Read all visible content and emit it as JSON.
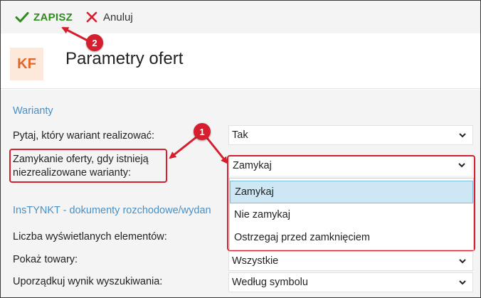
{
  "toolbar": {
    "save_label": "ZAPISZ",
    "cancel_label": "Anuluj"
  },
  "header": {
    "logo_text": "KF",
    "title": "Parametry ofert"
  },
  "sections": {
    "warianty": {
      "title": "Warianty",
      "rows": [
        {
          "label": "Pytaj, który wariant realizować:",
          "value": "Tak"
        },
        {
          "label_line1": "Zamykanie oferty, gdy istnieją",
          "label_line2": "niezrealizowane warianty:",
          "value": "Zamykaj"
        }
      ]
    },
    "instynkt": {
      "title": "InsTYNKT - dokumenty rozchodowe/wydan",
      "rows": [
        {
          "label": "Liczba wyświetlanych elementów:"
        },
        {
          "label": "Pokaż towary:",
          "value": "Wszystkie"
        },
        {
          "label": "Uporządkuj wynik wyszukiwania:",
          "value": "Według symbolu"
        }
      ]
    }
  },
  "dropdown": {
    "options": [
      "Zamykaj",
      "Nie zamykaj",
      "Ostrzegaj przed zamknięciem"
    ],
    "selected": "Zamykaj"
  },
  "annotations": {
    "badge1": "1",
    "badge2": "2"
  },
  "colors": {
    "accent_green": "#2e8b1e",
    "section_blue": "#4a8fc4",
    "highlight_red": "#d51f2f",
    "logo_orange": "#e0662b",
    "logo_bg": "#fde9dc",
    "selected_bg": "#cde8f4"
  }
}
